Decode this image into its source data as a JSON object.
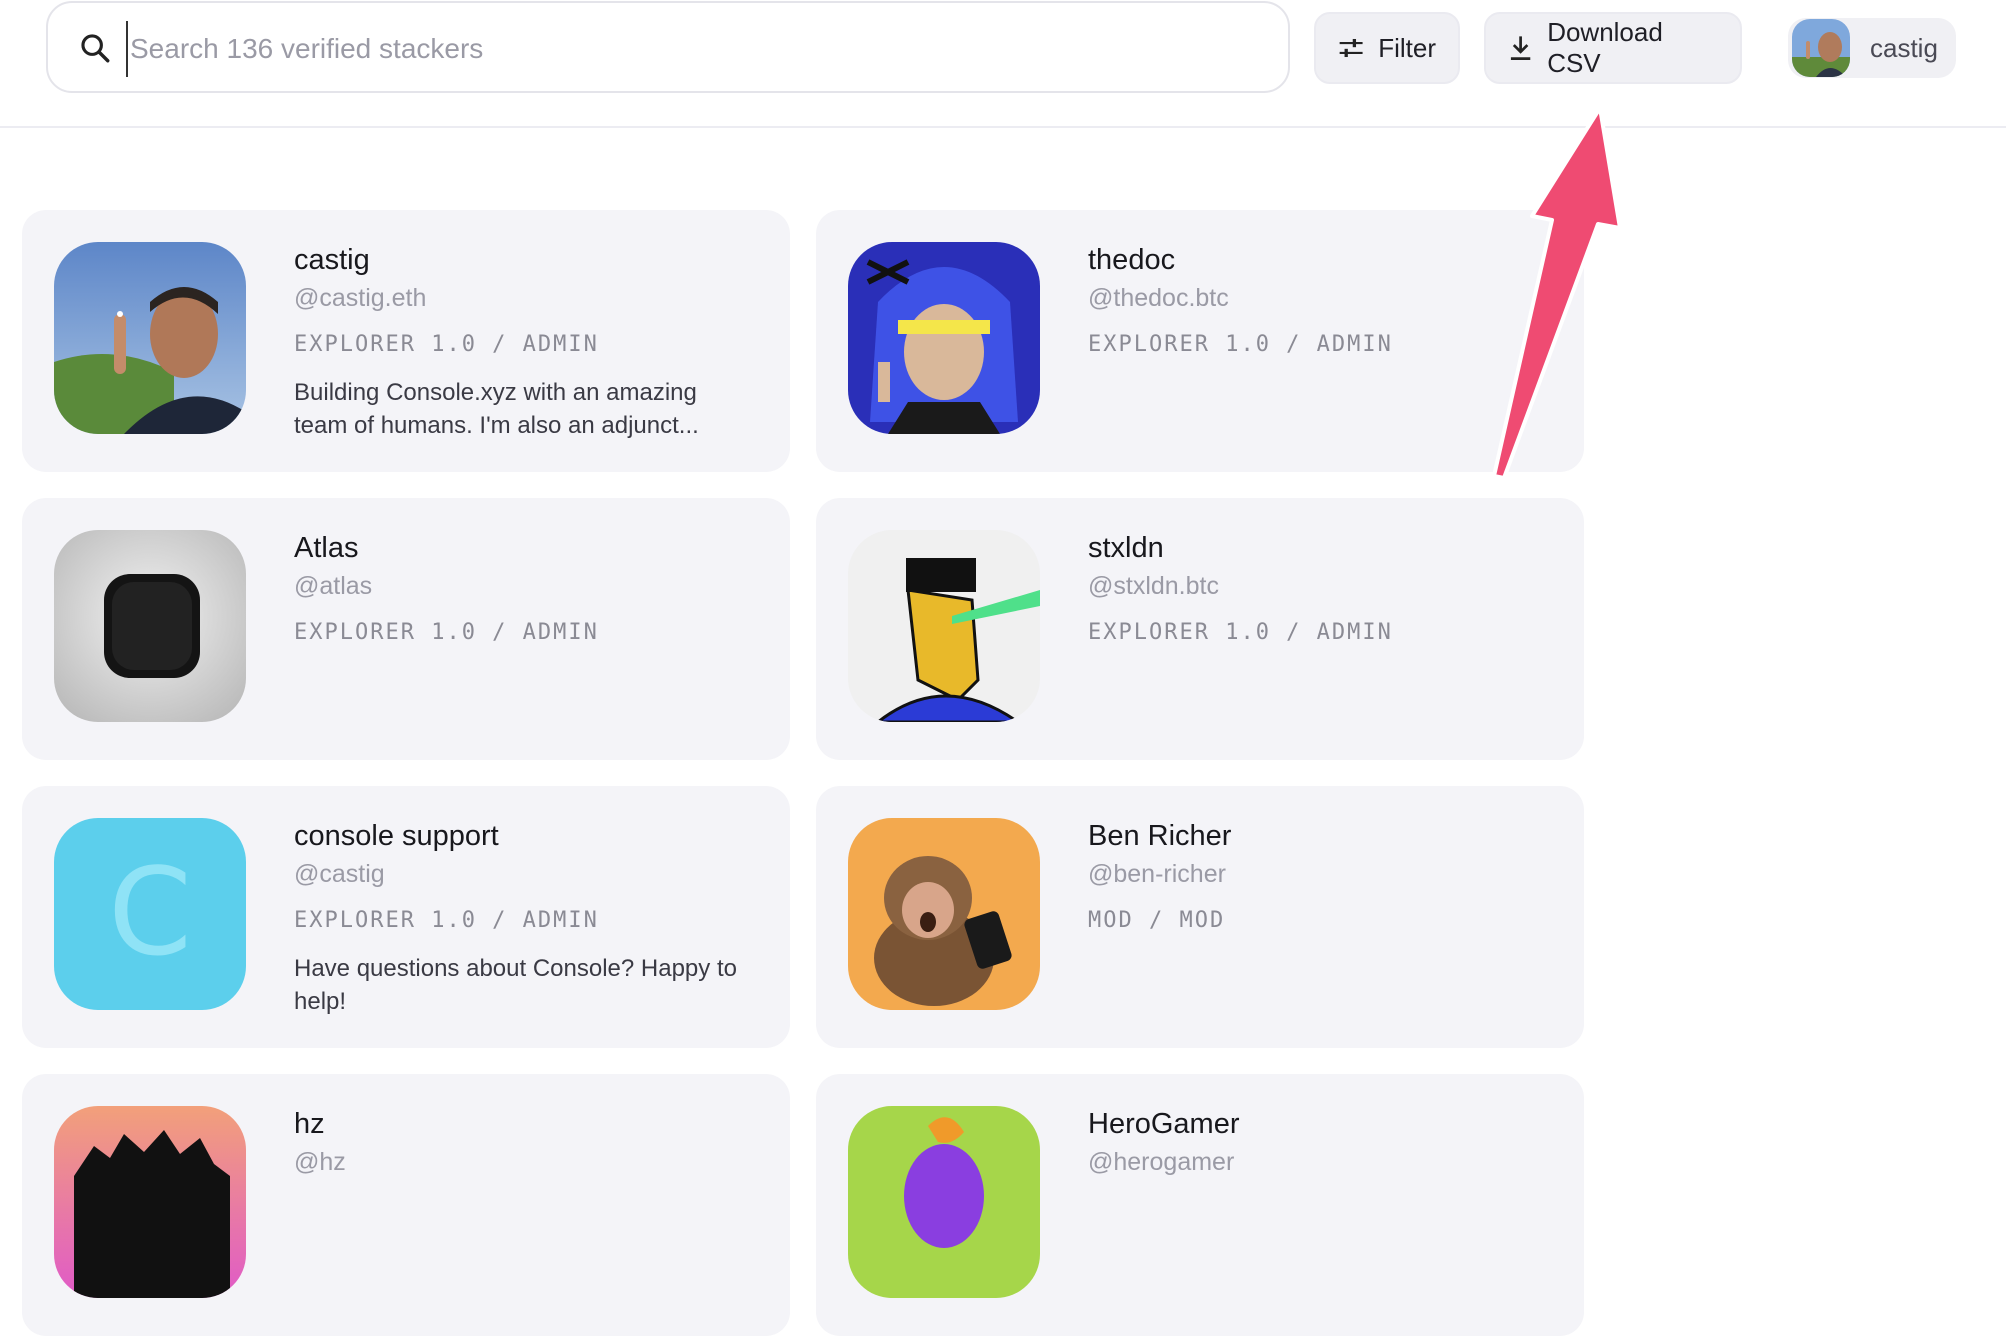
{
  "search": {
    "placeholder": "Search 136 verified stackers",
    "value": ""
  },
  "toolbar": {
    "filter_label": "Filter",
    "download_label": "Download CSV"
  },
  "user": {
    "name": "castig"
  },
  "members": [
    {
      "name": "castig",
      "handle": "@castig.eth",
      "role": "EXPLORER 1.0 / ADMIN",
      "bio": "Building Console.xyz with an amazing team of humans. I'm also an adjunct..."
    },
    {
      "name": "thedoc",
      "handle": "@thedoc.btc",
      "role": "EXPLORER 1.0 / ADMIN",
      "bio": ""
    },
    {
      "name": "Atlas",
      "handle": "@atlas",
      "role": "EXPLORER 1.0 / ADMIN",
      "bio": ""
    },
    {
      "name": "stxldn",
      "handle": "@stxldn.btc",
      "role": "EXPLORER 1.0 / ADMIN",
      "bio": ""
    },
    {
      "name": "console support",
      "handle": "@castig",
      "role": "EXPLORER 1.0 / ADMIN",
      "bio": "Have questions about Console? Happy to help!"
    },
    {
      "name": "Ben Richer",
      "handle": "@ben-richer",
      "role": "MOD / MOD",
      "bio": ""
    },
    {
      "name": "hz",
      "handle": "@hz",
      "role": "",
      "bio": ""
    },
    {
      "name": "HeroGamer",
      "handle": "@herogamer",
      "role": "",
      "bio": ""
    }
  ],
  "console_avatar_letter": "C",
  "colors": {
    "accent_arrow": "#ef4b72",
    "card_bg": "#f4f4f8",
    "console_avatar": "#5ccfec"
  }
}
